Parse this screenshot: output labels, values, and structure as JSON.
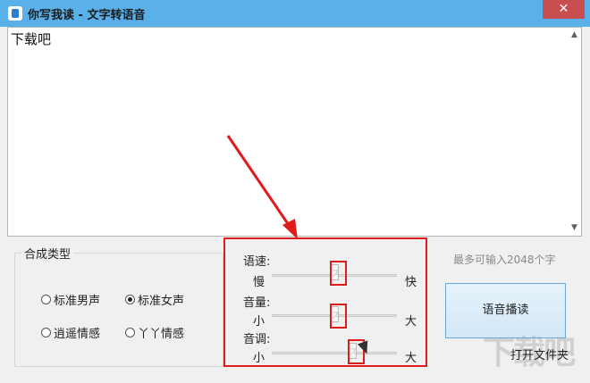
{
  "window": {
    "title": "你写我读 - 文字转语音",
    "close_glyph": "✕"
  },
  "text_input": {
    "value": "下载吧"
  },
  "synthesis": {
    "group_title": "合成类型",
    "options": [
      {
        "label": "标准男声",
        "checked": false
      },
      {
        "label": "标准女声",
        "checked": true
      },
      {
        "label": "逍遥情感",
        "checked": false
      },
      {
        "label": "丫丫情感",
        "checked": false
      }
    ]
  },
  "sliders": [
    {
      "label": "语速:",
      "min_label": "慢",
      "max_label": "快",
      "level": 0.5
    },
    {
      "label": "音量:",
      "min_label": "小",
      "max_label": "大",
      "level": 0.5
    },
    {
      "label": "音调:",
      "min_label": "小",
      "max_label": "大",
      "level": 0.64
    }
  ],
  "max_chars_text": "最多可输入2048个字",
  "play_button": "语音播读",
  "open_folder": "打开文件夹",
  "watermark": "下载吧",
  "colors": {
    "titlebar": "#5ab0e9",
    "close_button": "#c74f50",
    "annotation_red": "#e01b1b",
    "play_button_border": "#6aa6d6"
  }
}
